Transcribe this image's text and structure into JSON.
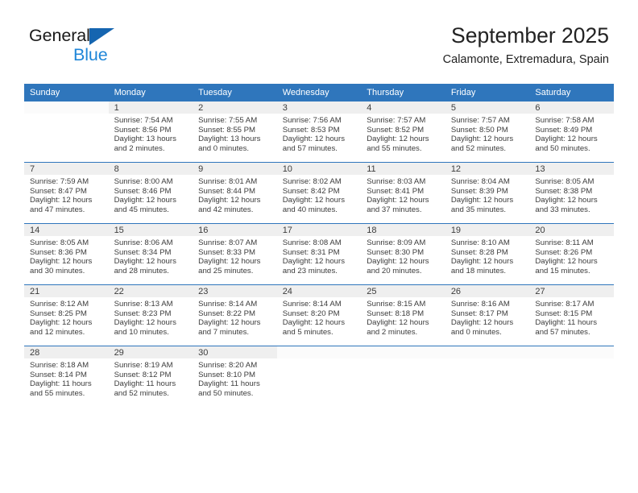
{
  "brand": {
    "name_part1": "General",
    "name_part2": "Blue",
    "logo_icon": "triangle-flag-icon"
  },
  "header": {
    "title": "September 2025",
    "subtitle": "Calamonte, Extremadura, Spain"
  },
  "weekday_headers": [
    "Sunday",
    "Monday",
    "Tuesday",
    "Wednesday",
    "Thursday",
    "Friday",
    "Saturday"
  ],
  "colors": {
    "header_blue": "#2f76bc",
    "brand_blue": "#1f86d8",
    "logo_blue": "#1565b0",
    "daynum_band": "#efefef",
    "text": "#3c3c3c"
  },
  "weeks": [
    [
      {
        "day": "",
        "sunrise": "",
        "sunset": "",
        "daylight_line1": "",
        "daylight_line2": ""
      },
      {
        "day": "1",
        "sunrise": "Sunrise: 7:54 AM",
        "sunset": "Sunset: 8:56 PM",
        "daylight_line1": "Daylight: 13 hours",
        "daylight_line2": "and 2 minutes."
      },
      {
        "day": "2",
        "sunrise": "Sunrise: 7:55 AM",
        "sunset": "Sunset: 8:55 PM",
        "daylight_line1": "Daylight: 13 hours",
        "daylight_line2": "and 0 minutes."
      },
      {
        "day": "3",
        "sunrise": "Sunrise: 7:56 AM",
        "sunset": "Sunset: 8:53 PM",
        "daylight_line1": "Daylight: 12 hours",
        "daylight_line2": "and 57 minutes."
      },
      {
        "day": "4",
        "sunrise": "Sunrise: 7:57 AM",
        "sunset": "Sunset: 8:52 PM",
        "daylight_line1": "Daylight: 12 hours",
        "daylight_line2": "and 55 minutes."
      },
      {
        "day": "5",
        "sunrise": "Sunrise: 7:57 AM",
        "sunset": "Sunset: 8:50 PM",
        "daylight_line1": "Daylight: 12 hours",
        "daylight_line2": "and 52 minutes."
      },
      {
        "day": "6",
        "sunrise": "Sunrise: 7:58 AM",
        "sunset": "Sunset: 8:49 PM",
        "daylight_line1": "Daylight: 12 hours",
        "daylight_line2": "and 50 minutes."
      }
    ],
    [
      {
        "day": "7",
        "sunrise": "Sunrise: 7:59 AM",
        "sunset": "Sunset: 8:47 PM",
        "daylight_line1": "Daylight: 12 hours",
        "daylight_line2": "and 47 minutes."
      },
      {
        "day": "8",
        "sunrise": "Sunrise: 8:00 AM",
        "sunset": "Sunset: 8:46 PM",
        "daylight_line1": "Daylight: 12 hours",
        "daylight_line2": "and 45 minutes."
      },
      {
        "day": "9",
        "sunrise": "Sunrise: 8:01 AM",
        "sunset": "Sunset: 8:44 PM",
        "daylight_line1": "Daylight: 12 hours",
        "daylight_line2": "and 42 minutes."
      },
      {
        "day": "10",
        "sunrise": "Sunrise: 8:02 AM",
        "sunset": "Sunset: 8:42 PM",
        "daylight_line1": "Daylight: 12 hours",
        "daylight_line2": "and 40 minutes."
      },
      {
        "day": "11",
        "sunrise": "Sunrise: 8:03 AM",
        "sunset": "Sunset: 8:41 PM",
        "daylight_line1": "Daylight: 12 hours",
        "daylight_line2": "and 37 minutes."
      },
      {
        "day": "12",
        "sunrise": "Sunrise: 8:04 AM",
        "sunset": "Sunset: 8:39 PM",
        "daylight_line1": "Daylight: 12 hours",
        "daylight_line2": "and 35 minutes."
      },
      {
        "day": "13",
        "sunrise": "Sunrise: 8:05 AM",
        "sunset": "Sunset: 8:38 PM",
        "daylight_line1": "Daylight: 12 hours",
        "daylight_line2": "and 33 minutes."
      }
    ],
    [
      {
        "day": "14",
        "sunrise": "Sunrise: 8:05 AM",
        "sunset": "Sunset: 8:36 PM",
        "daylight_line1": "Daylight: 12 hours",
        "daylight_line2": "and 30 minutes."
      },
      {
        "day": "15",
        "sunrise": "Sunrise: 8:06 AM",
        "sunset": "Sunset: 8:34 PM",
        "daylight_line1": "Daylight: 12 hours",
        "daylight_line2": "and 28 minutes."
      },
      {
        "day": "16",
        "sunrise": "Sunrise: 8:07 AM",
        "sunset": "Sunset: 8:33 PM",
        "daylight_line1": "Daylight: 12 hours",
        "daylight_line2": "and 25 minutes."
      },
      {
        "day": "17",
        "sunrise": "Sunrise: 8:08 AM",
        "sunset": "Sunset: 8:31 PM",
        "daylight_line1": "Daylight: 12 hours",
        "daylight_line2": "and 23 minutes."
      },
      {
        "day": "18",
        "sunrise": "Sunrise: 8:09 AM",
        "sunset": "Sunset: 8:30 PM",
        "daylight_line1": "Daylight: 12 hours",
        "daylight_line2": "and 20 minutes."
      },
      {
        "day": "19",
        "sunrise": "Sunrise: 8:10 AM",
        "sunset": "Sunset: 8:28 PM",
        "daylight_line1": "Daylight: 12 hours",
        "daylight_line2": "and 18 minutes."
      },
      {
        "day": "20",
        "sunrise": "Sunrise: 8:11 AM",
        "sunset": "Sunset: 8:26 PM",
        "daylight_line1": "Daylight: 12 hours",
        "daylight_line2": "and 15 minutes."
      }
    ],
    [
      {
        "day": "21",
        "sunrise": "Sunrise: 8:12 AM",
        "sunset": "Sunset: 8:25 PM",
        "daylight_line1": "Daylight: 12 hours",
        "daylight_line2": "and 12 minutes."
      },
      {
        "day": "22",
        "sunrise": "Sunrise: 8:13 AM",
        "sunset": "Sunset: 8:23 PM",
        "daylight_line1": "Daylight: 12 hours",
        "daylight_line2": "and 10 minutes."
      },
      {
        "day": "23",
        "sunrise": "Sunrise: 8:14 AM",
        "sunset": "Sunset: 8:22 PM",
        "daylight_line1": "Daylight: 12 hours",
        "daylight_line2": "and 7 minutes."
      },
      {
        "day": "24",
        "sunrise": "Sunrise: 8:14 AM",
        "sunset": "Sunset: 8:20 PM",
        "daylight_line1": "Daylight: 12 hours",
        "daylight_line2": "and 5 minutes."
      },
      {
        "day": "25",
        "sunrise": "Sunrise: 8:15 AM",
        "sunset": "Sunset: 8:18 PM",
        "daylight_line1": "Daylight: 12 hours",
        "daylight_line2": "and 2 minutes."
      },
      {
        "day": "26",
        "sunrise": "Sunrise: 8:16 AM",
        "sunset": "Sunset: 8:17 PM",
        "daylight_line1": "Daylight: 12 hours",
        "daylight_line2": "and 0 minutes."
      },
      {
        "day": "27",
        "sunrise": "Sunrise: 8:17 AM",
        "sunset": "Sunset: 8:15 PM",
        "daylight_line1": "Daylight: 11 hours",
        "daylight_line2": "and 57 minutes."
      }
    ],
    [
      {
        "day": "28",
        "sunrise": "Sunrise: 8:18 AM",
        "sunset": "Sunset: 8:14 PM",
        "daylight_line1": "Daylight: 11 hours",
        "daylight_line2": "and 55 minutes."
      },
      {
        "day": "29",
        "sunrise": "Sunrise: 8:19 AM",
        "sunset": "Sunset: 8:12 PM",
        "daylight_line1": "Daylight: 11 hours",
        "daylight_line2": "and 52 minutes."
      },
      {
        "day": "30",
        "sunrise": "Sunrise: 8:20 AM",
        "sunset": "Sunset: 8:10 PM",
        "daylight_line1": "Daylight: 11 hours",
        "daylight_line2": "and 50 minutes."
      },
      {
        "day": "",
        "sunrise": "",
        "sunset": "",
        "daylight_line1": "",
        "daylight_line2": ""
      },
      {
        "day": "",
        "sunrise": "",
        "sunset": "",
        "daylight_line1": "",
        "daylight_line2": ""
      },
      {
        "day": "",
        "sunrise": "",
        "sunset": "",
        "daylight_line1": "",
        "daylight_line2": ""
      },
      {
        "day": "",
        "sunrise": "",
        "sunset": "",
        "daylight_line1": "",
        "daylight_line2": ""
      }
    ]
  ]
}
